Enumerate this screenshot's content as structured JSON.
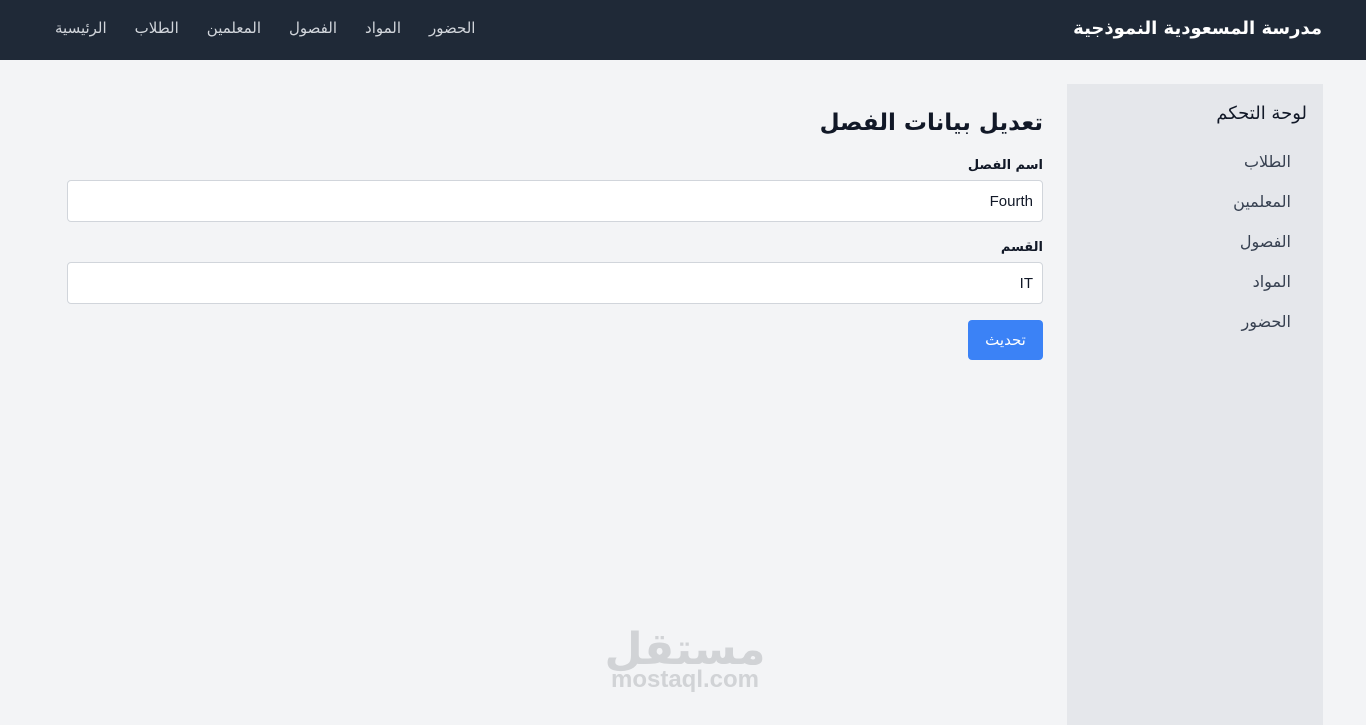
{
  "navbar": {
    "brand": "مدرسة المسعودية النموذجية",
    "links": [
      {
        "label": "الرئيسية"
      },
      {
        "label": "الطلاب"
      },
      {
        "label": "المعلمين"
      },
      {
        "label": "الفصول"
      },
      {
        "label": "المواد"
      },
      {
        "label": "الحضور"
      }
    ]
  },
  "sidebar": {
    "title": "لوحة التحكم",
    "items": [
      {
        "label": "الطلاب"
      },
      {
        "label": "المعلمين"
      },
      {
        "label": "الفصول"
      },
      {
        "label": "المواد"
      },
      {
        "label": "الحضور"
      }
    ]
  },
  "main": {
    "title": "تعديل بيانات الفصل",
    "fields": [
      {
        "label": "اسم الفصل",
        "value": "Fourth"
      },
      {
        "label": "القسم",
        "value": "IT"
      }
    ],
    "submit_label": "تحديث"
  },
  "watermark": {
    "arabic": "مستقل",
    "latin": "mostaql.com"
  },
  "colors": {
    "navbar_bg": "#1f2937",
    "page_bg": "#f3f4f6",
    "sidebar_bg": "#e5e7eb",
    "primary_button": "#3b82f6"
  }
}
